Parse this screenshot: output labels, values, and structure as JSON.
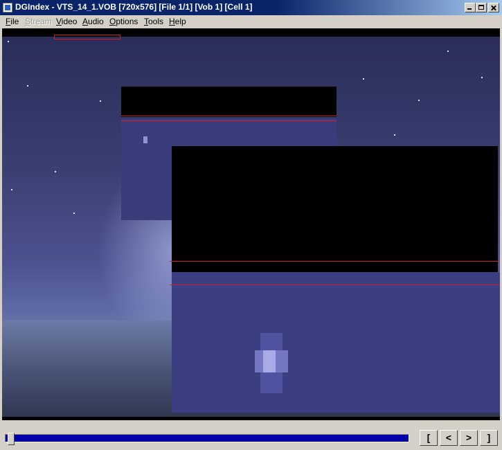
{
  "window": {
    "title": "DGIndex - VTS_14_1.VOB [720x576] [File 1/1] [Vob 1] [Cell 1]"
  },
  "menu": {
    "items": [
      {
        "first": "F",
        "rest": "ile",
        "disabled": false
      },
      {
        "first": "S",
        "rest": "tream",
        "disabled": true
      },
      {
        "first": "V",
        "rest": "ideo",
        "disabled": false
      },
      {
        "first": "A",
        "rest": "udio",
        "disabled": false
      },
      {
        "first": "O",
        "rest": "ptions",
        "disabled": false
      },
      {
        "first": "T",
        "rest": "ools",
        "disabled": false
      },
      {
        "first": "H",
        "rest": "elp",
        "disabled": false
      }
    ]
  },
  "controls": {
    "position_fraction": 0.0,
    "buttons": [
      {
        "label": "[",
        "icon": "mark-start-icon"
      },
      {
        "label": "<",
        "icon": "step-back-icon"
      },
      {
        "label": ">",
        "icon": "step-forward-icon"
      },
      {
        "label": "]",
        "icon": "mark-end-icon"
      }
    ]
  },
  "colors": {
    "titlebar": "#0a246a",
    "track_fill": "#0000a8",
    "crop_line": "#d31c2a"
  }
}
